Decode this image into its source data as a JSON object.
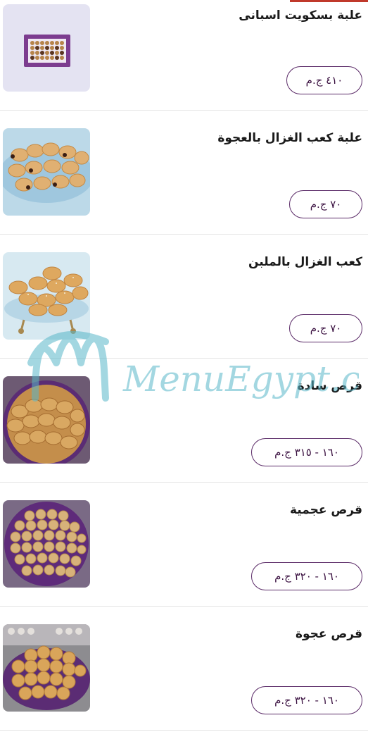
{
  "items": [
    {
      "name": "علبة بسكويت اسبانى",
      "price": "٤١٠ ج.م",
      "image": "biscuit-box"
    },
    {
      "name": "علبة كعب الغزال بالعجوة",
      "price": "٧٠ ج.م",
      "image": "kaab-ghazal-dates"
    },
    {
      "name": "كعب الغزال بالملبن",
      "price": "٧٠ ج.م",
      "image": "kaab-ghazal-malban"
    },
    {
      "name": "قرص سادة",
      "price": "١٦٠ - ٣١٥ ج.م",
      "image": "plain-qurs"
    },
    {
      "name": "قرص عجمية",
      "price": "١٦٠ - ٣٢٠ ج.م",
      "image": "ajamiya-qurs"
    },
    {
      "name": "قرص عجوة",
      "price": "١٦٠ - ٣٢٠ ج.م",
      "image": "dates-qurs"
    }
  ],
  "watermark": {
    "text": "MenuEgypt.com"
  },
  "colors": {
    "accent": "#c0392b",
    "price_border": "#5a2a67",
    "price_text": "#3a1040",
    "watermark": "#59b7c9"
  }
}
